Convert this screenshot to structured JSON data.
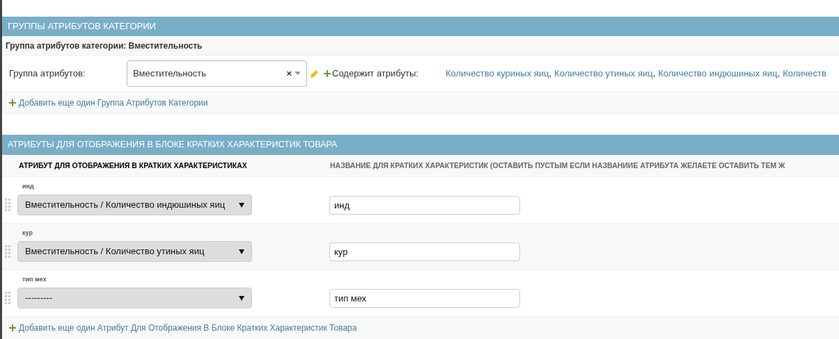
{
  "group_section": {
    "title": "ГРУППЫ АТРИБУТОВ КАТЕГОРИИ",
    "item_title": "Группа атрибутов категории: Вместительность",
    "field_label": "Группа атрибутов:",
    "field_value": "Вместительность",
    "clear": "×",
    "contains_label": "Содержит атрибуты:",
    "link_separator": ",",
    "links": [
      "Количество куриных яиц",
      "Количество утиных яиц",
      "Количество индюшиных яиц",
      "Количеств"
    ],
    "add_link": "Добавить еще один Группа Атрибутов Категории"
  },
  "short_section": {
    "title": "АТРИБУТЫ ДЛЯ ОТОБРАЖЕНИЯ В БЛОКЕ КРАТКИХ ХАРАКТЕРИСТИК ТОВАРА",
    "columns": [
      "АТРИБУТ ДЛЯ ОТОБРАЖЕНИЯ В КРАТКИХ ХАРАКТЕРИСТИКАХ",
      "НАЗВАНИЕ ДЛЯ КРАТКИХ ХАРАКТЕРИСТИК (ОСТАВИТЬ ПУСТЫМ ЕСЛИ НАЗВАНИИЕ АТРИБУТА ЖЕЛАЕТЕ ОСТАВИТЬ ТЕМ Ж"
    ],
    "rows": [
      {
        "label": "инд",
        "attribute": "Вместительность / Количество индюшиных яиц",
        "name": "инд"
      },
      {
        "label": "кур",
        "attribute": "Вместительность / Количество утиных яиц",
        "name": "кур"
      },
      {
        "label": "тип мех",
        "attribute": "---------",
        "name": "тип мех"
      }
    ],
    "add_link": "Добавить еще один Атрибут Для Отображения В Блоке Кратких Характеристик Товара"
  }
}
